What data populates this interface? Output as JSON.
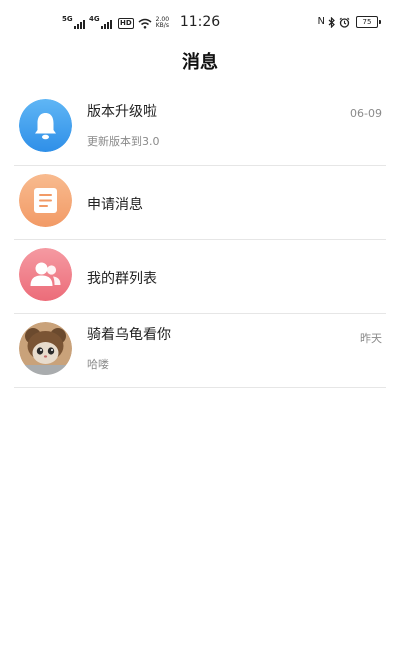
{
  "status_bar": {
    "sim1": "5G",
    "sim2": "4G",
    "hd": "HD",
    "speed_value": "2.00",
    "speed_unit": "KB/s",
    "time": "11:26",
    "battery": "75"
  },
  "header": {
    "title": "消息"
  },
  "messages": [
    {
      "name": "版本升级啦",
      "preview": "更新版本到3.0",
      "time": "06-09",
      "icon": "bell-icon",
      "color": "#3a9cf0"
    },
    {
      "name": "申请消息",
      "icon": "document-icon",
      "color": "#f5a97a"
    },
    {
      "name": "我的群列表",
      "icon": "group-icon",
      "color": "#f07a86"
    },
    {
      "name": "骑着乌龟看你",
      "preview": "哈喽",
      "time": "昨天",
      "icon": "user-avatar-photo"
    }
  ]
}
